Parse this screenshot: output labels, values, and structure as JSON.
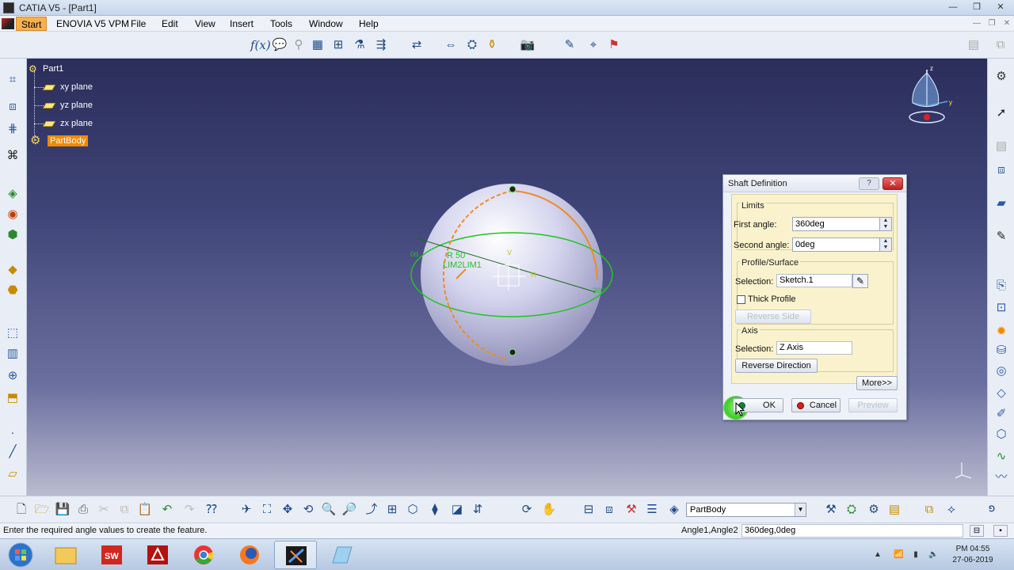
{
  "window": {
    "title": "CATIA V5 - [Part1]"
  },
  "menu": {
    "items": [
      "Start",
      "ENOVIA V5 VPM",
      "File",
      "Edit",
      "View",
      "Insert",
      "Tools",
      "Window",
      "Help"
    ]
  },
  "tree": {
    "root": "Part1",
    "planes": [
      "xy plane",
      "yz plane",
      "zx plane"
    ],
    "body": "PartBody"
  },
  "sketch_annotations": {
    "radius": "R 50",
    "limits": "LIM2LIM1",
    "v_axis": "V",
    "h_axis": "H",
    "left_angle": "0d",
    "right_angle": "360°"
  },
  "dialog": {
    "title": "Shaft Definition",
    "help": "?",
    "limits_group": "Limits",
    "first_angle_label": "First angle:",
    "first_angle_value": "360deg",
    "second_angle_label": "Second angle:",
    "second_angle_value": "0deg",
    "profile_group": "Profile/Surface",
    "selection_label": "Selection:",
    "profile_selection": "Sketch.1",
    "thick_profile_label": "Thick Profile",
    "thick_profile_checked": false,
    "reverse_side_label": "Reverse Side",
    "axis_group": "Axis",
    "axis_selection_label": "Selection:",
    "axis_selection": "Z Axis",
    "reverse_direction_label": "Reverse Direction",
    "more_label": "More>>",
    "ok_label": "OK",
    "cancel_label": "Cancel",
    "preview_label": "Preview"
  },
  "bottom": {
    "current_body": "PartBody"
  },
  "status": {
    "message": "Enter the required angle values to create the feature.",
    "param_label": "Angle1,Angle2",
    "param_value": "360deg,0deg"
  },
  "taskbar": {
    "time": "PM 04:55",
    "date": "27-06-2019"
  },
  "colors": {
    "accent_orange": "#f18a00",
    "sketch_green": "#22c422",
    "dialog_body": "#f9f2cc"
  }
}
